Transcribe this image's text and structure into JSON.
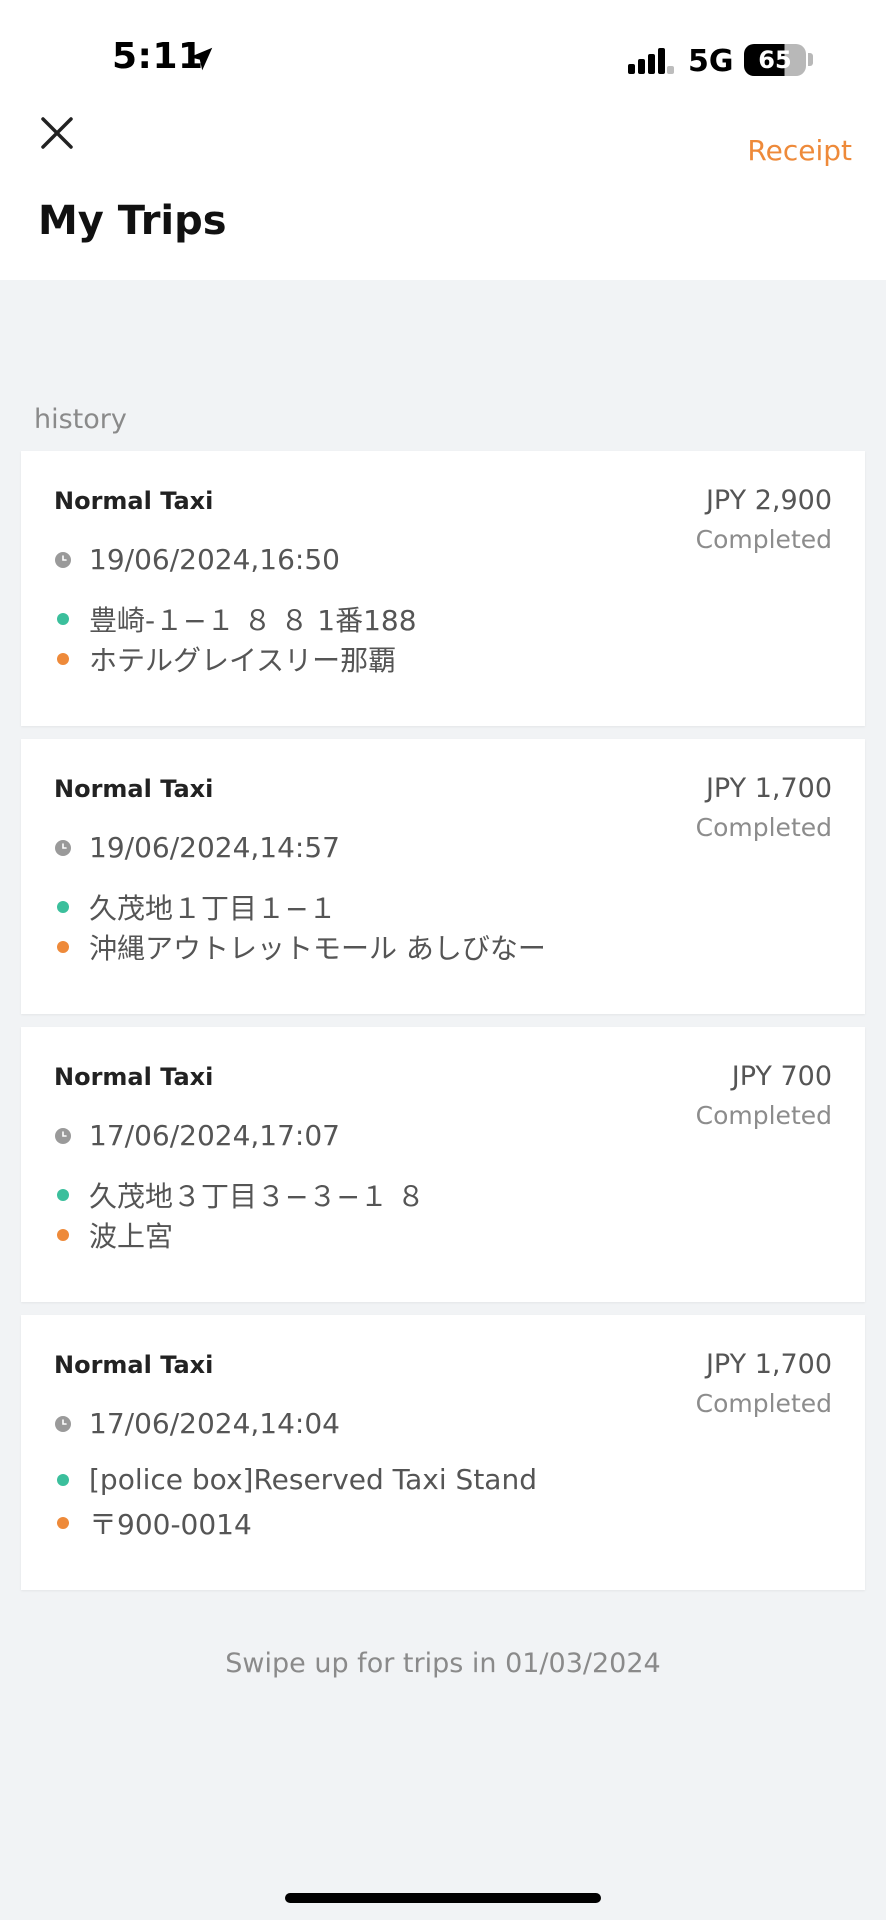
{
  "status_bar": {
    "time": "5:11",
    "network": "5G",
    "battery": "65"
  },
  "header": {
    "title": "My Trips",
    "receipt_label": "Receipt"
  },
  "section_label": "history",
  "trips": [
    {
      "type": "Normal Taxi",
      "price": "JPY 2,900",
      "status": "Completed",
      "datetime": "19/06/2024,16:50",
      "from": "豊崎-１−１ ８ ８ 1番188",
      "to": "ホテルグレイスリー那覇"
    },
    {
      "type": "Normal Taxi",
      "price": "JPY 1,700",
      "status": "Completed",
      "datetime": "19/06/2024,14:57",
      "from": "久茂地１丁目１−１",
      "to": "沖縄アウトレットモール あしびなー"
    },
    {
      "type": "Normal Taxi",
      "price": "JPY 700",
      "status": "Completed",
      "datetime": "17/06/2024,17:07",
      "from": "久茂地３丁目３−３−１ ８",
      "to": "波上宮"
    },
    {
      "type": "Normal Taxi",
      "price": "JPY 1,700",
      "status": "Completed",
      "datetime": "17/06/2024,14:04",
      "from": "[police box]Reserved Taxi Stand",
      "to": "〒900-0014"
    }
  ],
  "footer_text": "Swipe up for trips in 01/03/2024",
  "colors": {
    "accent": "#ee8a3a",
    "origin_dot": "#3bbf9c",
    "destination_dot": "#ee8a3a",
    "background": "#f1f3f5"
  },
  "icons": {
    "close": "close-icon",
    "clock": "clock-icon",
    "location": "location-arrow-icon"
  }
}
